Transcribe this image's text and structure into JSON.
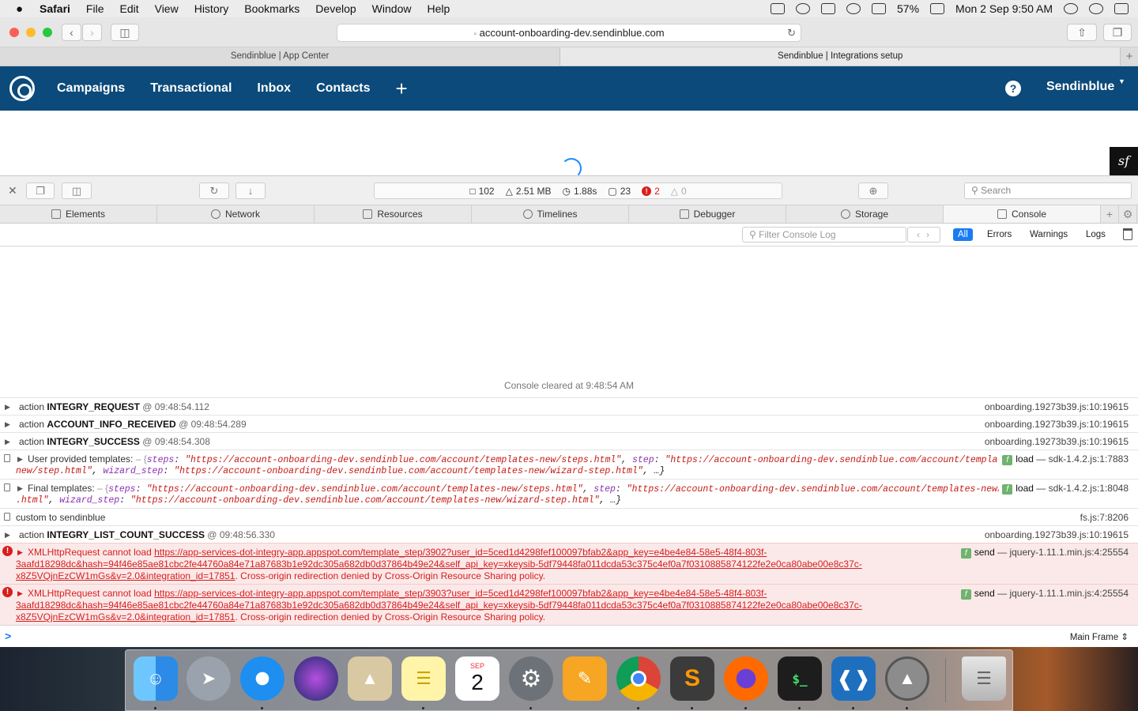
{
  "menubar": {
    "apple": "",
    "items": [
      "Safari",
      "File",
      "Edit",
      "View",
      "History",
      "Bookmarks",
      "Develop",
      "Window",
      "Help"
    ],
    "battery": "57%",
    "datetime": "Mon 2 Sep  9:50 AM"
  },
  "browser": {
    "url": "account-onboarding-dev.sendinblue.com",
    "tabs": [
      "Sendinblue | App Center",
      "Sendinblue | Integrations setup"
    ],
    "new_tab": "+"
  },
  "site_nav": {
    "items": [
      "Campaigns",
      "Transactional",
      "Inbox",
      "Contacts"
    ],
    "plus": "+",
    "help": "?",
    "account": "Sendinblue"
  },
  "inspector": {
    "stats": {
      "resources": "102",
      "size": "2.51 MB",
      "time": "1.88s",
      "logs": "23",
      "errors": "2",
      "warnings": "0"
    },
    "search_placeholder": "Search",
    "tabs": [
      "Elements",
      "Network",
      "Resources",
      "Timelines",
      "Debugger",
      "Storage",
      "Console"
    ],
    "filter_placeholder": "Filter Console Log",
    "filter_buttons": [
      "All",
      "Errors",
      "Warnings",
      "Logs"
    ]
  },
  "console": {
    "cleared": "Console cleared at 9:48:54 AM",
    "entries": [
      {
        "prefix": "action ",
        "name": "INTEGRY_REQUEST",
        "ts": "@ 09:48:54.112",
        "src": "onboarding.19273b39.js:10:19615"
      },
      {
        "prefix": "action ",
        "name": "ACCOUNT_INFO_RECEIVED",
        "ts": "@ 09:48:54.289",
        "src": "onboarding.19273b39.js:10:19615"
      },
      {
        "prefix": "action ",
        "name": "INTEGRY_SUCCESS",
        "ts": "@ 09:48:54.308",
        "src": "onboarding.19273b39.js:10:19615"
      },
      {
        "label": "User provided templates:",
        "open": " – {",
        "k1": "steps",
        "v1": "\"https://account-onboarding-dev.sendinblue.com/account/templates-new/steps.html\"",
        "k2": "step",
        "v2": "\"https://account-onboarding-dev.sendinblue.com/account/templates-",
        "line2a": "new/step.html\"",
        "k3": "wizard_step",
        "v3": "\"https://account-onboarding-dev.sendinblue.com/account/templates-new/wizard-step.html\"",
        "tail": ", …}",
        "fn": "load",
        "src": "— sdk-1.4.2.js:1:7883"
      },
      {
        "label": "Final templates:",
        "open": " – {",
        "k1": "steps",
        "v1": "\"https://account-onboarding-dev.sendinblue.com/account/templates-new/steps.html\"",
        "k2": "step",
        "v2": "\"https://account-onboarding-dev.sendinblue.com/account/templates-new/step",
        "line2a": ".html\"",
        "k3": "wizard_step",
        "v3": "\"https://account-onboarding-dev.sendinblue.com/account/templates-new/wizard-step.html\"",
        "tail": ", …}",
        "fn": "load",
        "src": "— sdk-1.4.2.js:1:8048"
      },
      {
        "text": "custom to sendinblue",
        "src": "fs.js:7:8206"
      },
      {
        "prefix": "action ",
        "name": "INTEGRY_LIST_COUNT_SUCCESS",
        "ts": "@ 09:48:56.330",
        "src": "onboarding.19273b39.js:10:19615"
      }
    ],
    "errors": [
      {
        "lead": "XMLHttpRequest cannot load ",
        "url1": "https://app-services-dot-integry-app.appspot.com/template_step/3902?user_id=5ced1d4298fef100097bfab2&app_key=e4be4e84-58e5-48f4-803f-",
        "url2": "3aafd18298dc&hash=94f46e85ae81cbc2fe44760a84e71a87683b1e92dc305a682db0d37864b49e24&self_api_key=xkeysib-5df79448fa011dcda53c375c4ef0a7f0310885874122fe2e0ca80abe00e8c37c-",
        "url3": "x8Z5VQjnEzCW1mGs&v=2.0&integration_id=17851",
        "msg": ". Cross-origin redirection denied by Cross-Origin Resource Sharing policy.",
        "fn": "send",
        "src": "— jquery-1.11.1.min.js:4:25554"
      },
      {
        "lead": "XMLHttpRequest cannot load ",
        "url1": "https://app-services-dot-integry-app.appspot.com/template_step/3903?user_id=5ced1d4298fef100097bfab2&app_key=e4be4e84-58e5-48f4-803f-",
        "url2": "3aafd18298dc&hash=94f46e85ae81cbc2fe44760a84e71a87683b1e92dc305a682db0d37864b49e24&self_api_key=xkeysib-5df79448fa011dcda53c375c4ef0a7f0310885874122fe2e0ca80abe00e8c37c-",
        "url3": "x8Z5VQjnEzCW1mGs&v=2.0&integration_id=17851",
        "msg": ". Cross-origin redirection denied by Cross-Origin Resource Sharing policy.",
        "fn": "send",
        "src": "— jquery-1.11.1.min.js:4:25554"
      }
    ],
    "prompt": ">",
    "frame": "Main Frame ⇕"
  },
  "dock": {
    "icons": [
      "finder-icon",
      "launchpad-icon",
      "safari-icon",
      "siri-icon",
      "preview-icon",
      "notes-icon",
      "calendar-icon",
      "system-preferences-icon",
      "pages-icon",
      "chrome-icon",
      "sublime-text-icon",
      "firefox-icon",
      "terminal-icon",
      "vscode-icon",
      "sequel-pro-icon",
      "trash-icon"
    ],
    "calendar_month": "SEP",
    "calendar_day": "2",
    "terminal_glyph": "$_"
  },
  "colors": {
    "brand_nav": "#0b4a7a",
    "accent": "#1a7cf2",
    "error": "#d81e1e"
  }
}
